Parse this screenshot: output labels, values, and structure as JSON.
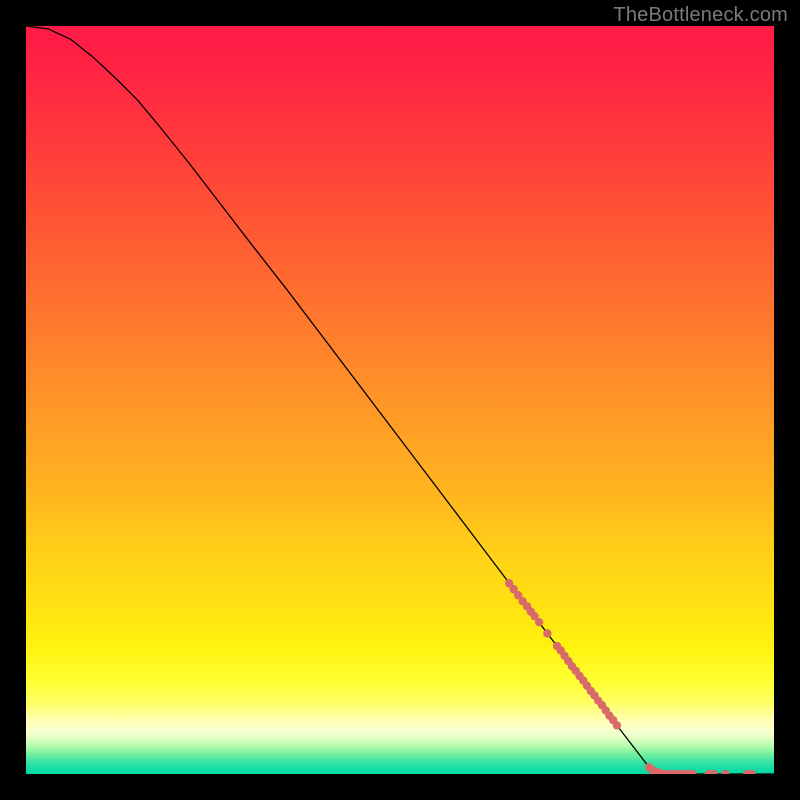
{
  "watermark": "TheBottleneck.com",
  "chart_data": {
    "type": "line",
    "title": "",
    "xlabel": "",
    "ylabel": "",
    "x_range": [
      0,
      100
    ],
    "y_range": [
      0,
      100
    ],
    "grid": false,
    "background": {
      "type": "vertical-gradient",
      "stops": [
        {
          "offset": 0.0,
          "color": "#ff1a47"
        },
        {
          "offset": 0.06,
          "color": "#ff2443"
        },
        {
          "offset": 0.16,
          "color": "#ff3b3b"
        },
        {
          "offset": 0.28,
          "color": "#ff5a33"
        },
        {
          "offset": 0.4,
          "color": "#ff7a2d"
        },
        {
          "offset": 0.52,
          "color": "#ff9a27"
        },
        {
          "offset": 0.62,
          "color": "#ffb41f"
        },
        {
          "offset": 0.7,
          "color": "#ffcf18"
        },
        {
          "offset": 0.77,
          "color": "#ffe012"
        },
        {
          "offset": 0.83,
          "color": "#fff20f"
        },
        {
          "offset": 0.875,
          "color": "#ffff30"
        },
        {
          "offset": 0.905,
          "color": "#ffff66"
        },
        {
          "offset": 0.928,
          "color": "#ffffb0"
        },
        {
          "offset": 0.943,
          "color": "#f7ffd0"
        },
        {
          "offset": 0.955,
          "color": "#d8ffc0"
        },
        {
          "offset": 0.965,
          "color": "#a8f8a8"
        },
        {
          "offset": 0.974,
          "color": "#70eea0"
        },
        {
          "offset": 0.983,
          "color": "#40e4a4"
        },
        {
          "offset": 0.992,
          "color": "#18dea6"
        },
        {
          "offset": 1.0,
          "color": "#00d9a3"
        }
      ]
    },
    "series": [
      {
        "name": "curve",
        "type": "line",
        "color": "#000000",
        "width": 1.3,
        "points": [
          {
            "x": 0.0,
            "y": 100.0
          },
          {
            "x": 3.0,
            "y": 99.6
          },
          {
            "x": 6.0,
            "y": 98.2
          },
          {
            "x": 9.0,
            "y": 95.8
          },
          {
            "x": 12.0,
            "y": 93.0
          },
          {
            "x": 15.0,
            "y": 90.0
          },
          {
            "x": 18.0,
            "y": 86.4
          },
          {
            "x": 22.0,
            "y": 81.4
          },
          {
            "x": 26.0,
            "y": 76.2
          },
          {
            "x": 30.0,
            "y": 71.0
          },
          {
            "x": 35.0,
            "y": 64.6
          },
          {
            "x": 40.0,
            "y": 58.0
          },
          {
            "x": 45.0,
            "y": 51.4
          },
          {
            "x": 50.0,
            "y": 44.8
          },
          {
            "x": 55.0,
            "y": 38.2
          },
          {
            "x": 60.0,
            "y": 31.6
          },
          {
            "x": 65.0,
            "y": 25.0
          },
          {
            "x": 70.0,
            "y": 18.4
          },
          {
            "x": 75.0,
            "y": 11.8
          },
          {
            "x": 80.0,
            "y": 5.2
          },
          {
            "x": 83.0,
            "y": 1.3
          },
          {
            "x": 85.0,
            "y": 0.0
          },
          {
            "x": 100.0,
            "y": 0.0
          }
        ]
      },
      {
        "name": "dots",
        "type": "scatter",
        "color": "#d86a6a",
        "radius": 4.2,
        "points": [
          {
            "x": 64.6,
            "y": 25.5
          },
          {
            "x": 65.2,
            "y": 24.7
          },
          {
            "x": 65.8,
            "y": 23.9
          },
          {
            "x": 66.4,
            "y": 23.1
          },
          {
            "x": 67.0,
            "y": 22.4
          },
          {
            "x": 67.5,
            "y": 21.7
          },
          {
            "x": 68.0,
            "y": 21.1
          },
          {
            "x": 68.6,
            "y": 20.3
          },
          {
            "x": 69.7,
            "y": 18.8
          },
          {
            "x": 71.0,
            "y": 17.1
          },
          {
            "x": 71.5,
            "y": 16.5
          },
          {
            "x": 72.0,
            "y": 15.8
          },
          {
            "x": 72.5,
            "y": 15.1
          },
          {
            "x": 73.0,
            "y": 14.4
          },
          {
            "x": 73.5,
            "y": 13.8
          },
          {
            "x": 74.0,
            "y": 13.1
          },
          {
            "x": 74.5,
            "y": 12.5
          },
          {
            "x": 75.0,
            "y": 11.8
          },
          {
            "x": 75.5,
            "y": 11.1
          },
          {
            "x": 76.0,
            "y": 10.5
          },
          {
            "x": 76.5,
            "y": 9.8
          },
          {
            "x": 77.0,
            "y": 9.2
          },
          {
            "x": 77.5,
            "y": 8.5
          },
          {
            "x": 78.0,
            "y": 7.8
          },
          {
            "x": 78.5,
            "y": 7.2
          },
          {
            "x": 79.0,
            "y": 6.5
          },
          {
            "x": 83.3,
            "y": 0.9
          },
          {
            "x": 83.8,
            "y": 0.5
          },
          {
            "x": 84.3,
            "y": 0.25
          },
          {
            "x": 84.8,
            "y": 0.1
          },
          {
            "x": 85.4,
            "y": 0.0
          },
          {
            "x": 86.0,
            "y": 0.0
          },
          {
            "x": 86.6,
            "y": 0.0
          },
          {
            "x": 87.2,
            "y": 0.0
          },
          {
            "x": 87.8,
            "y": 0.0
          },
          {
            "x": 88.5,
            "y": 0.0
          },
          {
            "x": 89.1,
            "y": 0.0
          },
          {
            "x": 91.3,
            "y": 0.0
          },
          {
            "x": 91.9,
            "y": 0.0
          },
          {
            "x": 93.5,
            "y": 0.0
          },
          {
            "x": 96.4,
            "y": 0.0
          },
          {
            "x": 97.0,
            "y": 0.0
          }
        ]
      }
    ]
  }
}
